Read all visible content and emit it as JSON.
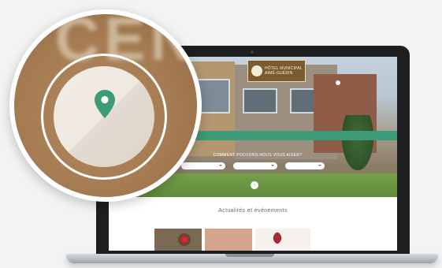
{
  "site": {
    "logo_text": "Hôtel municipal Aimé-Guérin",
    "top_links": "",
    "alert_text": "",
    "nav_items": [
      "",
      "",
      "",
      ""
    ],
    "help_title": "Comment pouvons-nous vous aider?",
    "help_selects": [
      "",
      "",
      ""
    ],
    "news_title": "Actualités et événements",
    "news_subtitle": "",
    "card_tag": ""
  },
  "colors": {
    "brand_green": "#3d9b77",
    "logo_brown": "#7a5a2f",
    "laptop_body": "#1d1e20"
  },
  "icons": {
    "magnifier_pin": "map-pin-icon"
  },
  "magnifier": {
    "background_text": "CEN"
  }
}
